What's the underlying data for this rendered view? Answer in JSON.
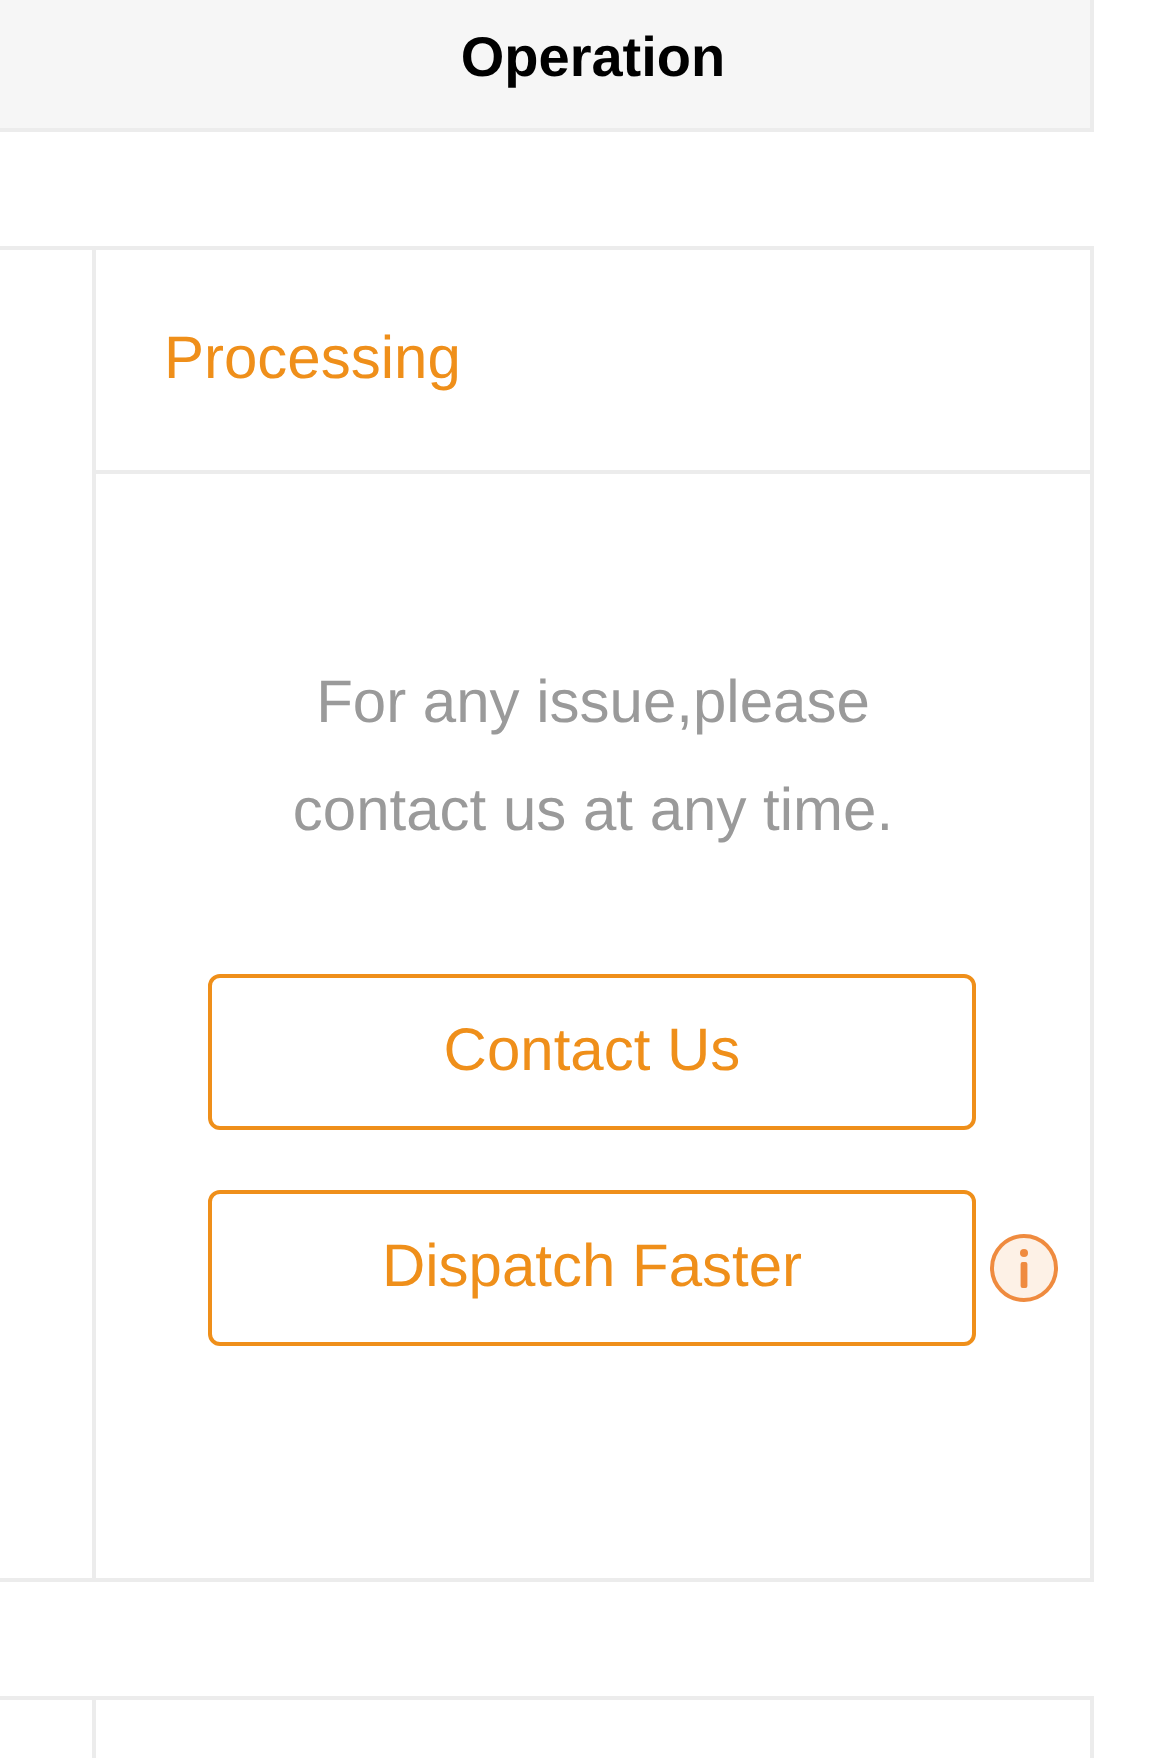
{
  "header": {
    "title": "Operation"
  },
  "orders": [
    {
      "status": "Processing",
      "message": "For any issue,please contact us at any time.",
      "buttons": [
        {
          "label": "Contact Us",
          "info": false
        },
        {
          "label": "Dispatch Faster",
          "info": true
        }
      ]
    }
  ]
}
